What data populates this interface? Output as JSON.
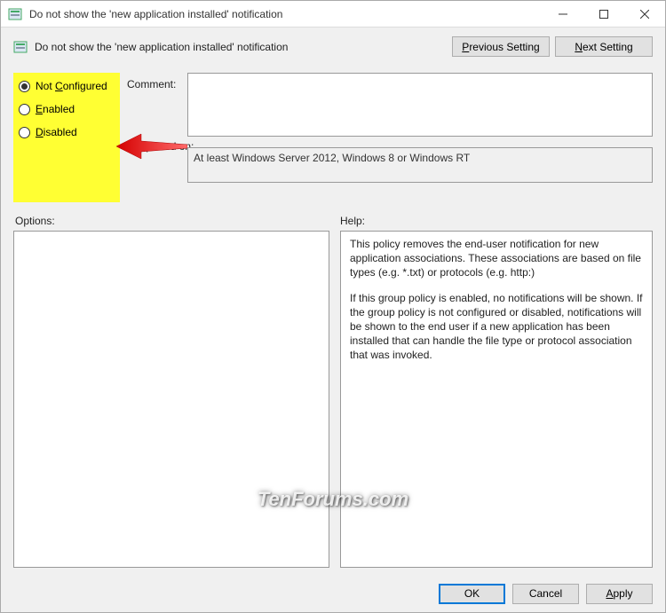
{
  "titlebar": {
    "title": "Do not show the 'new application installed' notification"
  },
  "header": {
    "policy_title": "Do not show the 'new application installed' notification",
    "prev_label": "Previous Setting",
    "next_label": "Next Setting"
  },
  "radios": {
    "not_configured": "Not Configured",
    "enabled": "Enabled",
    "disabled": "Disabled",
    "selected": "not_configured"
  },
  "fields": {
    "comment_label": "Comment:",
    "comment_value": "",
    "supported_label": "Supported on:",
    "supported_value": "At least Windows Server 2012, Windows 8 or Windows RT"
  },
  "labels": {
    "options": "Options:",
    "help": "Help:"
  },
  "help": {
    "p1": "This policy removes the end-user notification for new application associations. These associations are based on file types (e.g. *.txt) or protocols (e.g. http:)",
    "p2": "If this group policy is enabled, no notifications will be shown. If the group policy is not configured or disabled, notifications will be shown to the end user if a new application has been installed that can handle the file type or protocol association that was invoked."
  },
  "footer": {
    "ok": "OK",
    "cancel": "Cancel",
    "apply": "Apply"
  },
  "watermark": "TenForums.com"
}
